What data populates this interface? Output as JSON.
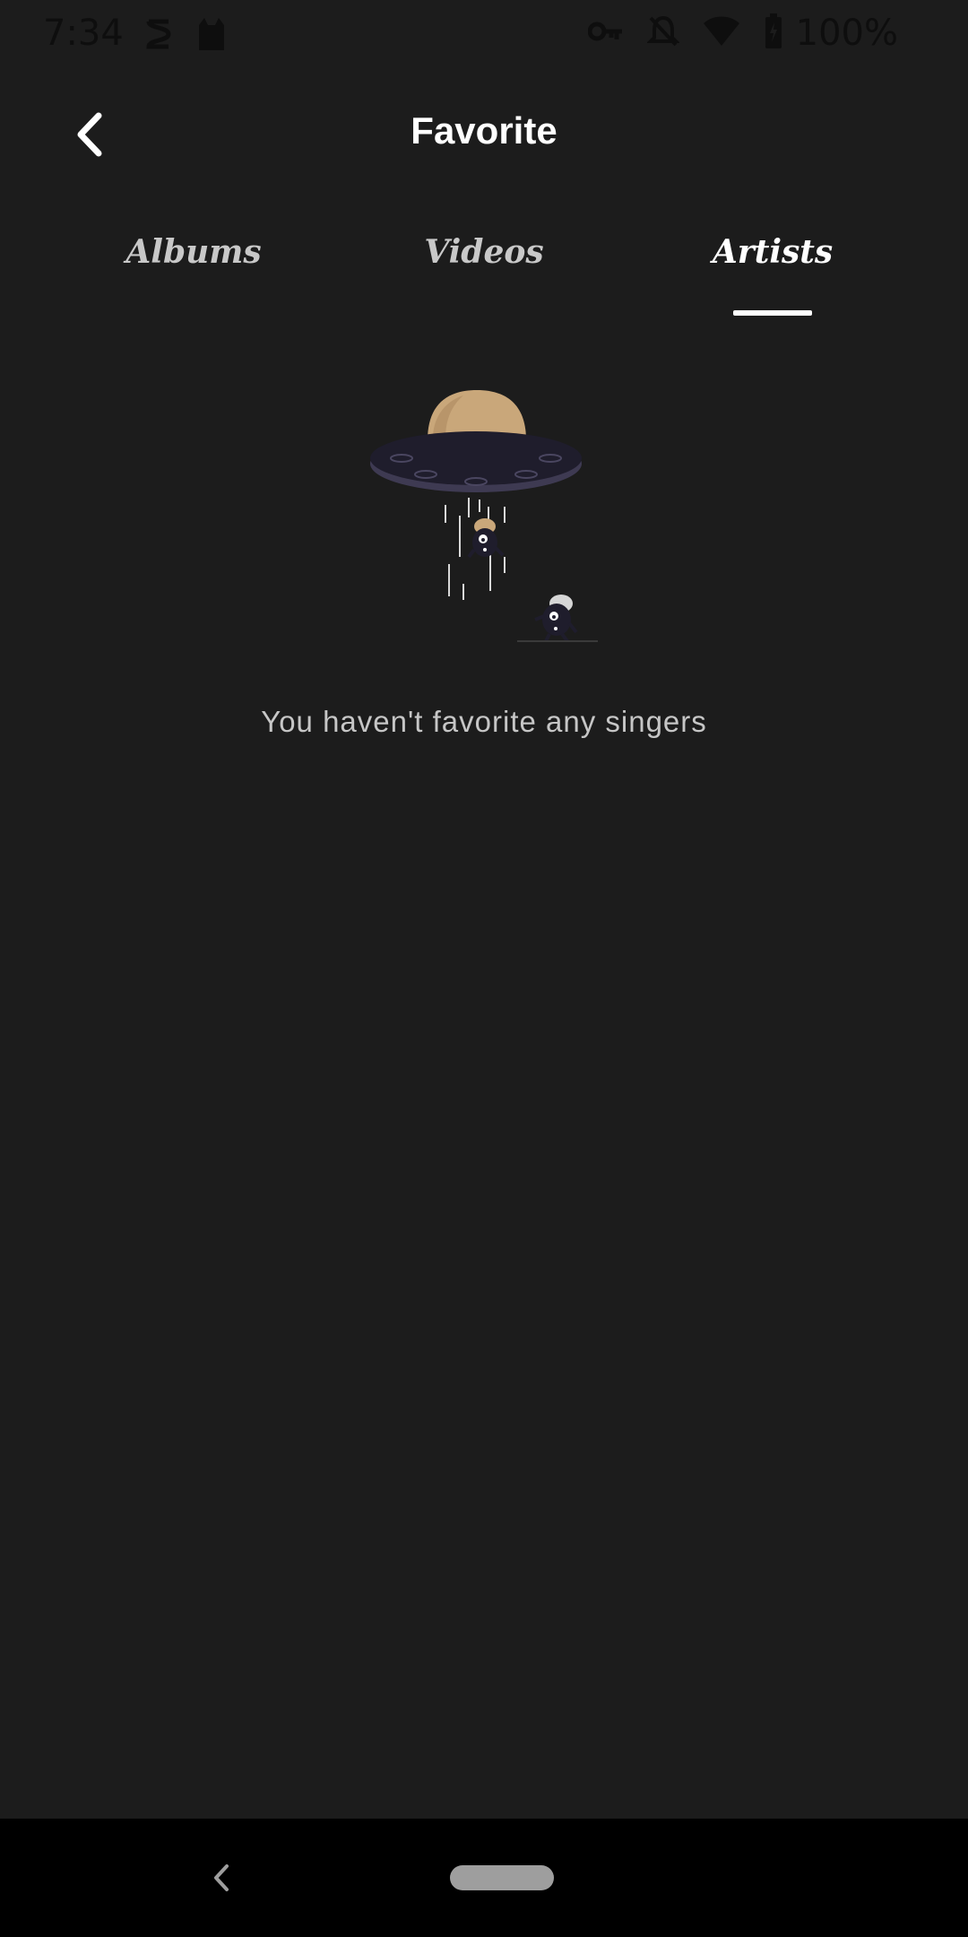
{
  "status_bar": {
    "time": "7:34",
    "battery": "100%",
    "icons": [
      "sync-icon",
      "cat-icon",
      "vpn-key-icon",
      "notifications-off-icon",
      "wifi-icon",
      "battery-charging-icon"
    ]
  },
  "header": {
    "title": "Favorite",
    "back_icon": "chevron-left-icon"
  },
  "tabs": [
    {
      "label": "Albums",
      "active": false
    },
    {
      "label": "Videos",
      "active": false
    },
    {
      "label": "Artists",
      "active": true
    }
  ],
  "empty_state": {
    "illustration": "ufo-abduction-illustration",
    "message": "You haven't favorite any singers"
  },
  "colors": {
    "background": "#1c1c1c",
    "text_primary": "#ffffff",
    "text_secondary": "#c6c6c6",
    "ufo_dome": "#c9a77a",
    "ufo_body": "#1f1d2c",
    "nav_bar": "#000000"
  },
  "nav_bar": {
    "back_icon": "triangle-back-icon",
    "home_icon": "home-pill-icon"
  }
}
